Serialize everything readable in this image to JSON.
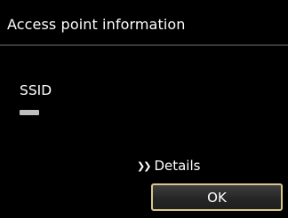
{
  "header": {
    "title": "Access point information"
  },
  "main": {
    "ssid_label": "SSID",
    "details_link": {
      "icon": "double-chevron-right-icon",
      "label": "Details"
    },
    "ok_button": {
      "label": "OK"
    }
  },
  "colors": {
    "background": "#000000",
    "text": "#ffffff",
    "button_border": "#d9c88a"
  }
}
